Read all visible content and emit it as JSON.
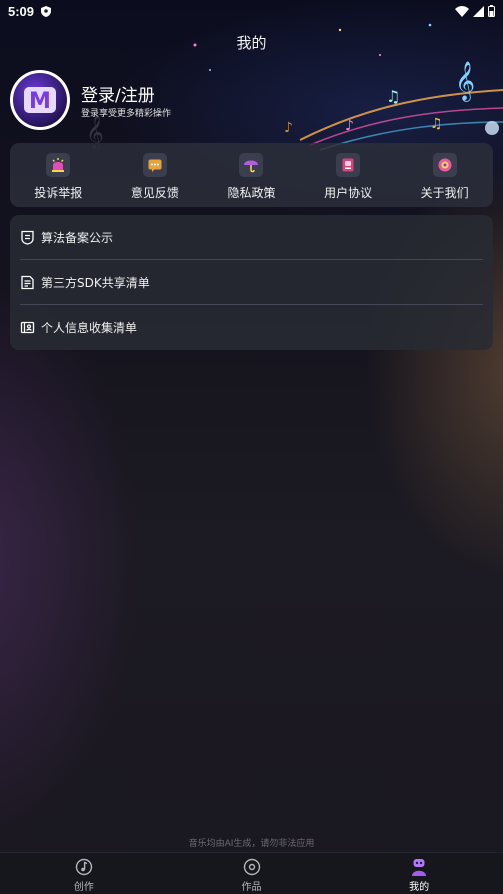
{
  "status_bar": {
    "time": "5:09"
  },
  "header": {
    "title": "我的"
  },
  "profile": {
    "avatar_letter": "M",
    "login_label": "登录/注册",
    "login_subtitle": "登录享受更多精彩操作"
  },
  "actions": [
    {
      "label": "投诉举报",
      "icon": "report-icon",
      "color": "#e44db9"
    },
    {
      "label": "意见反馈",
      "icon": "feedback-icon",
      "color": "#e6a33b"
    },
    {
      "label": "隐私政策",
      "icon": "umbrella-icon",
      "color": "#b55be0"
    },
    {
      "label": "用户协议",
      "icon": "agreement-icon",
      "color": "#d6447b"
    },
    {
      "label": "关于我们",
      "icon": "about-icon",
      "color": "#e85aa1"
    }
  ],
  "list": [
    {
      "label": "算法备案公示",
      "icon": "shield-doc-icon"
    },
    {
      "label": "第三方SDK共享清单",
      "icon": "document-list-icon"
    },
    {
      "label": "个人信息收集清单",
      "icon": "id-card-icon"
    }
  ],
  "disclaimer": "音乐均由AI生成，请勿非法应用",
  "tabs": [
    {
      "label": "创作",
      "icon": "music-note-icon",
      "active": false
    },
    {
      "label": "作品",
      "icon": "disc-icon",
      "active": false
    },
    {
      "label": "我的",
      "icon": "robot-icon",
      "active": true
    }
  ],
  "colors": {
    "accent": "#a35cf0",
    "card_bg": "#2c2f3a",
    "background": "#15151c"
  }
}
